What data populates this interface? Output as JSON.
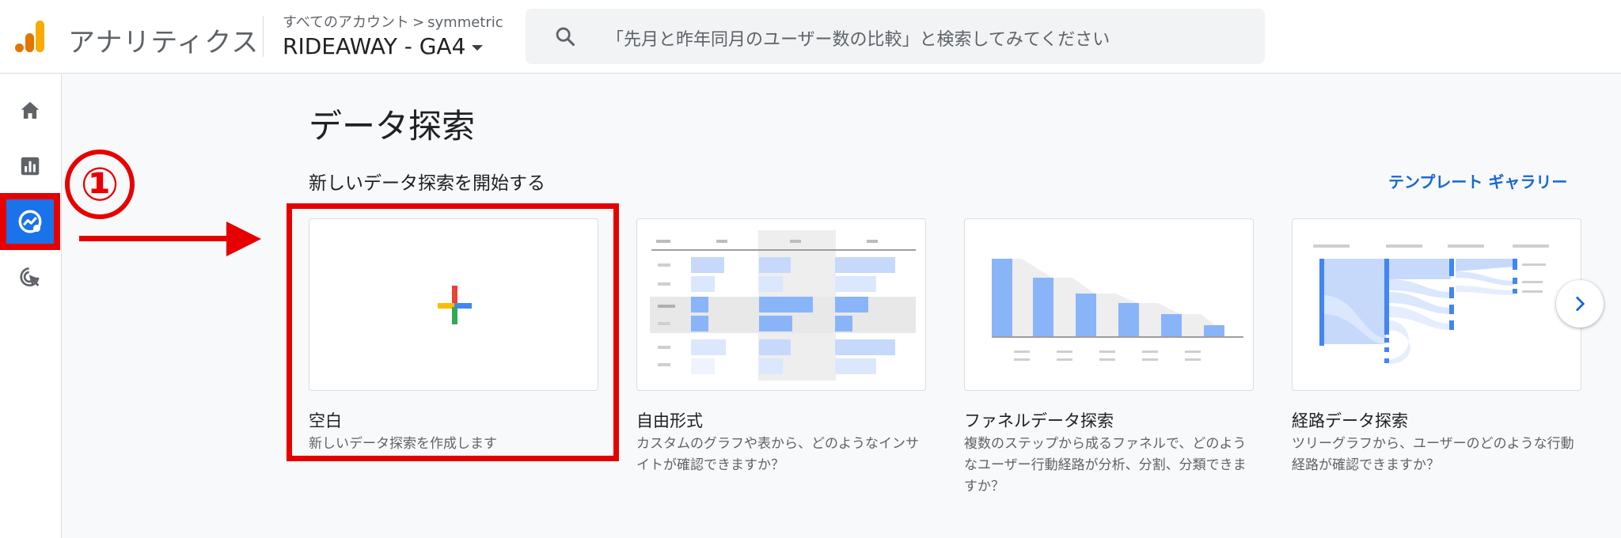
{
  "header": {
    "app_name": "アナリティクス",
    "breadcrumb": {
      "account": "すべてのアカウント",
      "separator": ">",
      "property": "symmetric"
    },
    "property_name": "RIDEAWAY - GA4",
    "search_placeholder": "「先月と昨年同月のユーザー数の比較」と検索してみてください"
  },
  "sidebar": {
    "items": [
      {
        "name": "home",
        "icon": "home-icon"
      },
      {
        "name": "reports",
        "icon": "bar-chart-icon"
      },
      {
        "name": "explore",
        "icon": "explore-icon",
        "active": true
      },
      {
        "name": "advertising",
        "icon": "cursor-target-icon"
      }
    ]
  },
  "annotation": {
    "step_marker": "①"
  },
  "main": {
    "page_title": "データ探索",
    "section_title": "新しいデータ探索を開始する",
    "template_gallery_link": "テンプレート ギャラリー",
    "cards": [
      {
        "title": "空白",
        "description": "新しいデータ探索を作成します"
      },
      {
        "title": "自由形式",
        "description": "カスタムのグラフや表から、どのようなインサイトが確認できますか？"
      },
      {
        "title": "ファネルデータ探索",
        "description": "複数のステップから成るファネルで、どのようなユーザー行動経路が分析、分割、分類できますか？"
      },
      {
        "title": "経路データ探索",
        "description": "ツリーグラフから、ユーザーのどのような行動経路が確認できますか？"
      }
    ]
  },
  "colors": {
    "accent_blue": "#1a73e8",
    "highlight_red": "#e60000",
    "chart_blue": "#8ab4f8",
    "chart_light_blue": "#d2e3fc"
  }
}
